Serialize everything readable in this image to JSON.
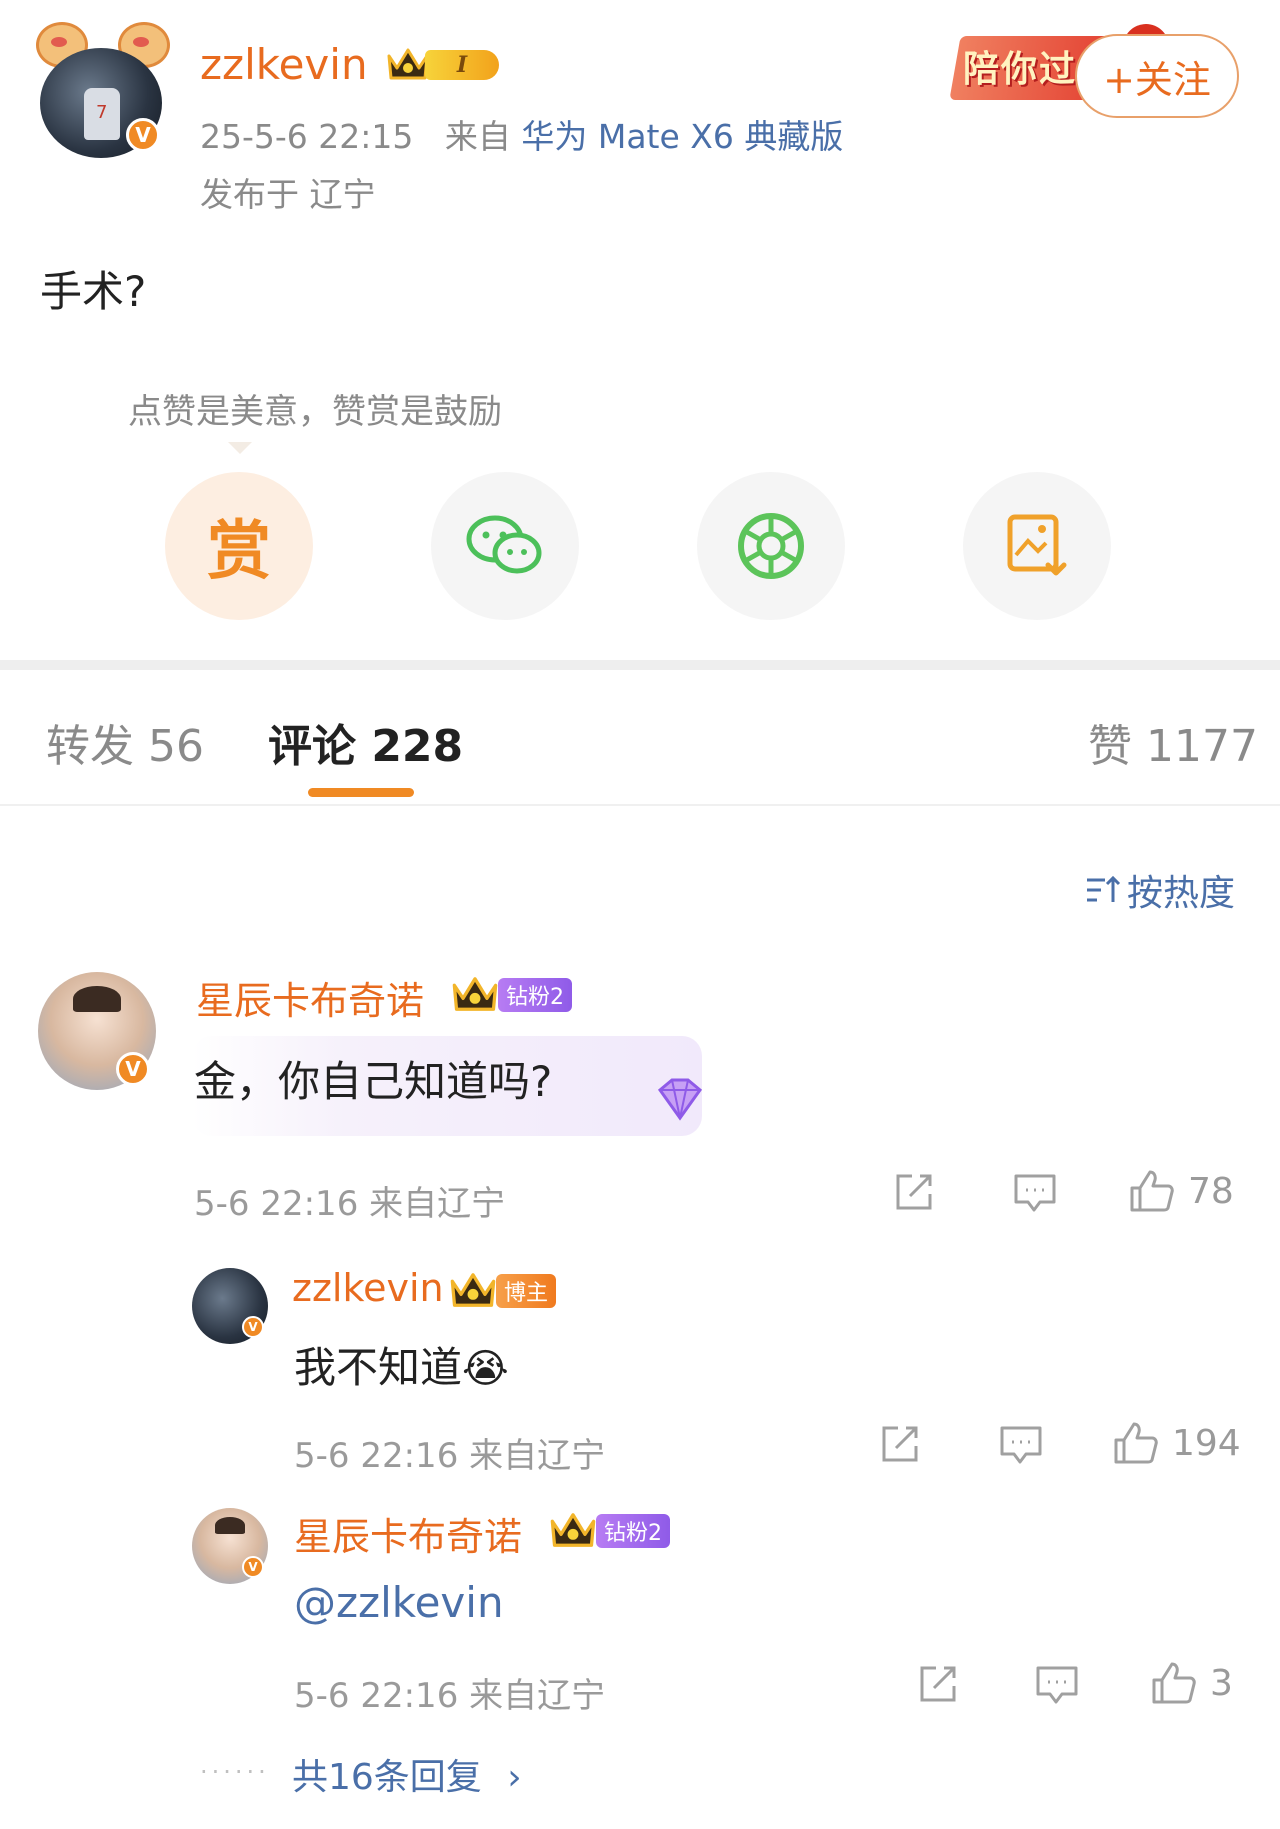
{
  "post": {
    "author": "zzlkevin",
    "level": "I",
    "time": "25-5-6 22:15",
    "from_prefix": "来自",
    "device": "华为 Mate X6 典藏版",
    "location": "发布于 辽宁",
    "text": "手术?",
    "promo_text": "陪你过",
    "follow_label": "+关注",
    "reward_hint": "点赞是美意，赞赏是鼓励",
    "reward_char": "赏"
  },
  "tabs": {
    "repost": "转发 56",
    "comments": "评论 228",
    "likes": "赞 1177"
  },
  "sort_label": "按热度",
  "comments": [
    {
      "name": "星辰卡布奇诺",
      "badge": "钻粉2",
      "text": "金，你自己知道吗?",
      "meta": "5-6 22:16 来自辽宁",
      "likes": "78"
    },
    {
      "name": "zzlkevin",
      "badge": "博主",
      "text": "我不知道",
      "emoji": "😭",
      "meta": "5-6 22:16 来自辽宁",
      "likes": "194"
    },
    {
      "name": "星辰卡布奇诺",
      "badge": "钻粉2",
      "text": "@zzlkevin",
      "meta": "5-6 22:16 来自辽宁",
      "likes": "3"
    }
  ],
  "more_replies": "共16条回复",
  "colors": {
    "accent": "#f08a24",
    "name": "#e86b1f",
    "link": "#4a6fa8",
    "fan_badge": "#9b64ee"
  }
}
